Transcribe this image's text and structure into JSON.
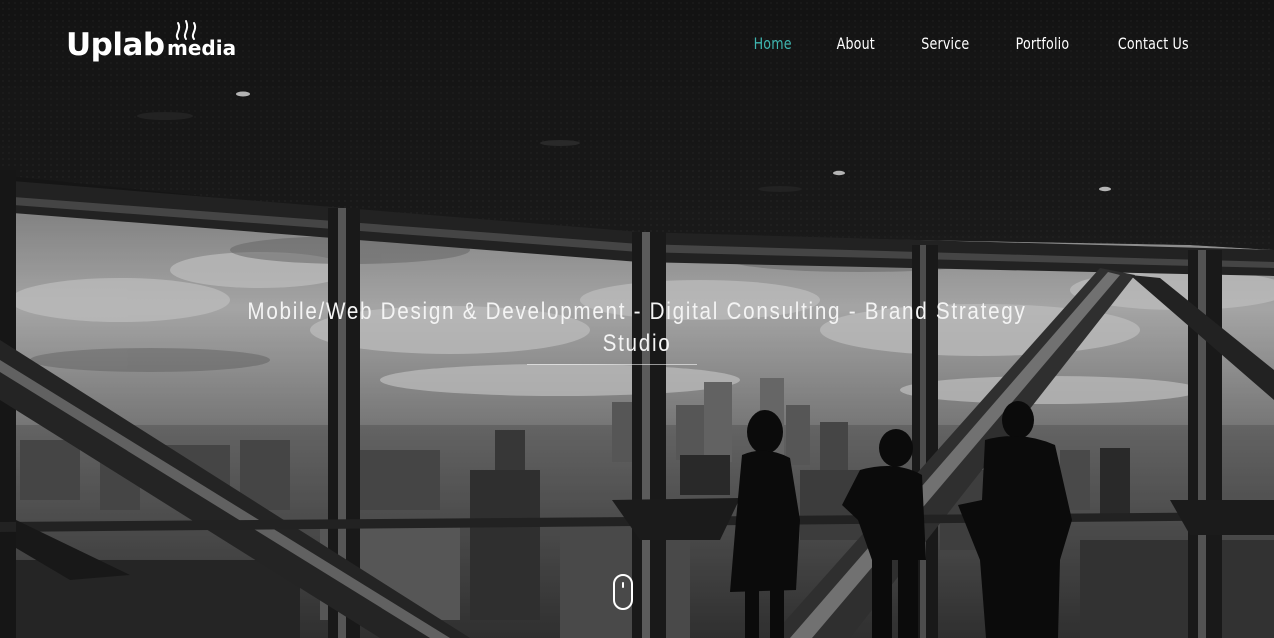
{
  "brand": {
    "name_main": "Uplab",
    "name_sub": "media",
    "icon": "steam-icon"
  },
  "nav": {
    "items": [
      {
        "label": "Home",
        "active": true
      },
      {
        "label": "About",
        "active": false
      },
      {
        "label": "Service",
        "active": false
      },
      {
        "label": "Portfolio",
        "active": false
      },
      {
        "label": "Contact Us",
        "active": false
      }
    ]
  },
  "hero": {
    "headline_line1": "Mobile/Web Design & Development - Digital Consulting - Brand Strategy",
    "headline_line2": "Studio",
    "background": "grayscale-office-skyline-photo",
    "scroll_icon": "mouse-scroll-icon"
  },
  "colors": {
    "accent": "#3fb6b0",
    "nav_text": "#ffffff",
    "headline_text": "#f4f4f4"
  }
}
